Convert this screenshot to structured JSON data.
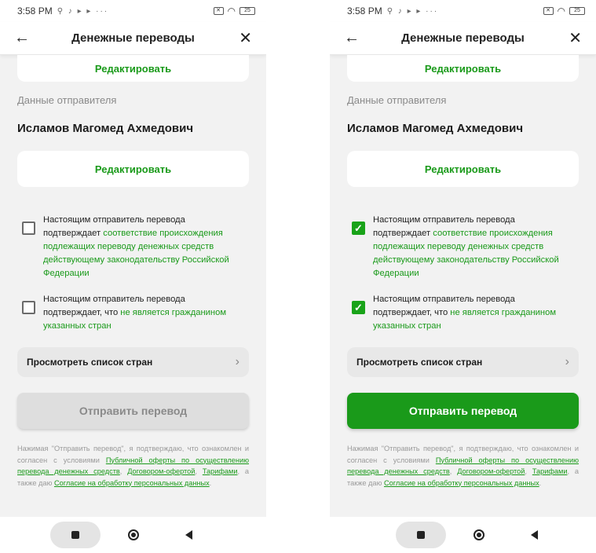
{
  "statusbar": {
    "time": "3:58 PM",
    "icons": "⚲ ♪ ▸ ▸ ···",
    "battery": "25"
  },
  "header": {
    "title": "Денежные переводы"
  },
  "top_card": {
    "edit_label": "Редактировать"
  },
  "sender": {
    "section_label": "Данные отправителя",
    "name": "Исламов Магомед Ахмедович",
    "edit_label": "Редактировать"
  },
  "checkbox1": {
    "prefix_line1": "Настоящим отправитель перевода",
    "prefix_line2": "подтверждает ",
    "link": "соответствие происхождения подлежащих переводу денежных средств действующему законодательству Российской Федерации"
  },
  "checkbox2": {
    "prefix_line1": "Настоящим отправитель перевода",
    "prefix_line2": "подтверждает, что ",
    "link": "не является гражданином указанных стран"
  },
  "countries": {
    "label": "Просмотреть список стран"
  },
  "submit": {
    "label": "Отправить перевод"
  },
  "legal": {
    "text1": "Нажимая \"Отправить перевод\", я подтверждаю, что ознакомлен и согласен с условиями ",
    "link1": "Публичной оферты по осуществлению перевода денежных средств",
    "text2": ", ",
    "link2": "Договором-офертой",
    "text3": ", ",
    "link3": "Тарифами",
    "text4": ", а также даю ",
    "link4": "Согласие на обработку персональных данных",
    "text5": "."
  },
  "screens": [
    {
      "state": "unchecked",
      "checkbox1_checked": false,
      "checkbox2_checked": false,
      "submit_enabled": false
    },
    {
      "state": "checked",
      "checkbox1_checked": true,
      "checkbox2_checked": true,
      "submit_enabled": true
    }
  ],
  "colors": {
    "accent": "#1a9a1a",
    "background": "#f2f2f2",
    "disabled_button": "#dedede"
  }
}
